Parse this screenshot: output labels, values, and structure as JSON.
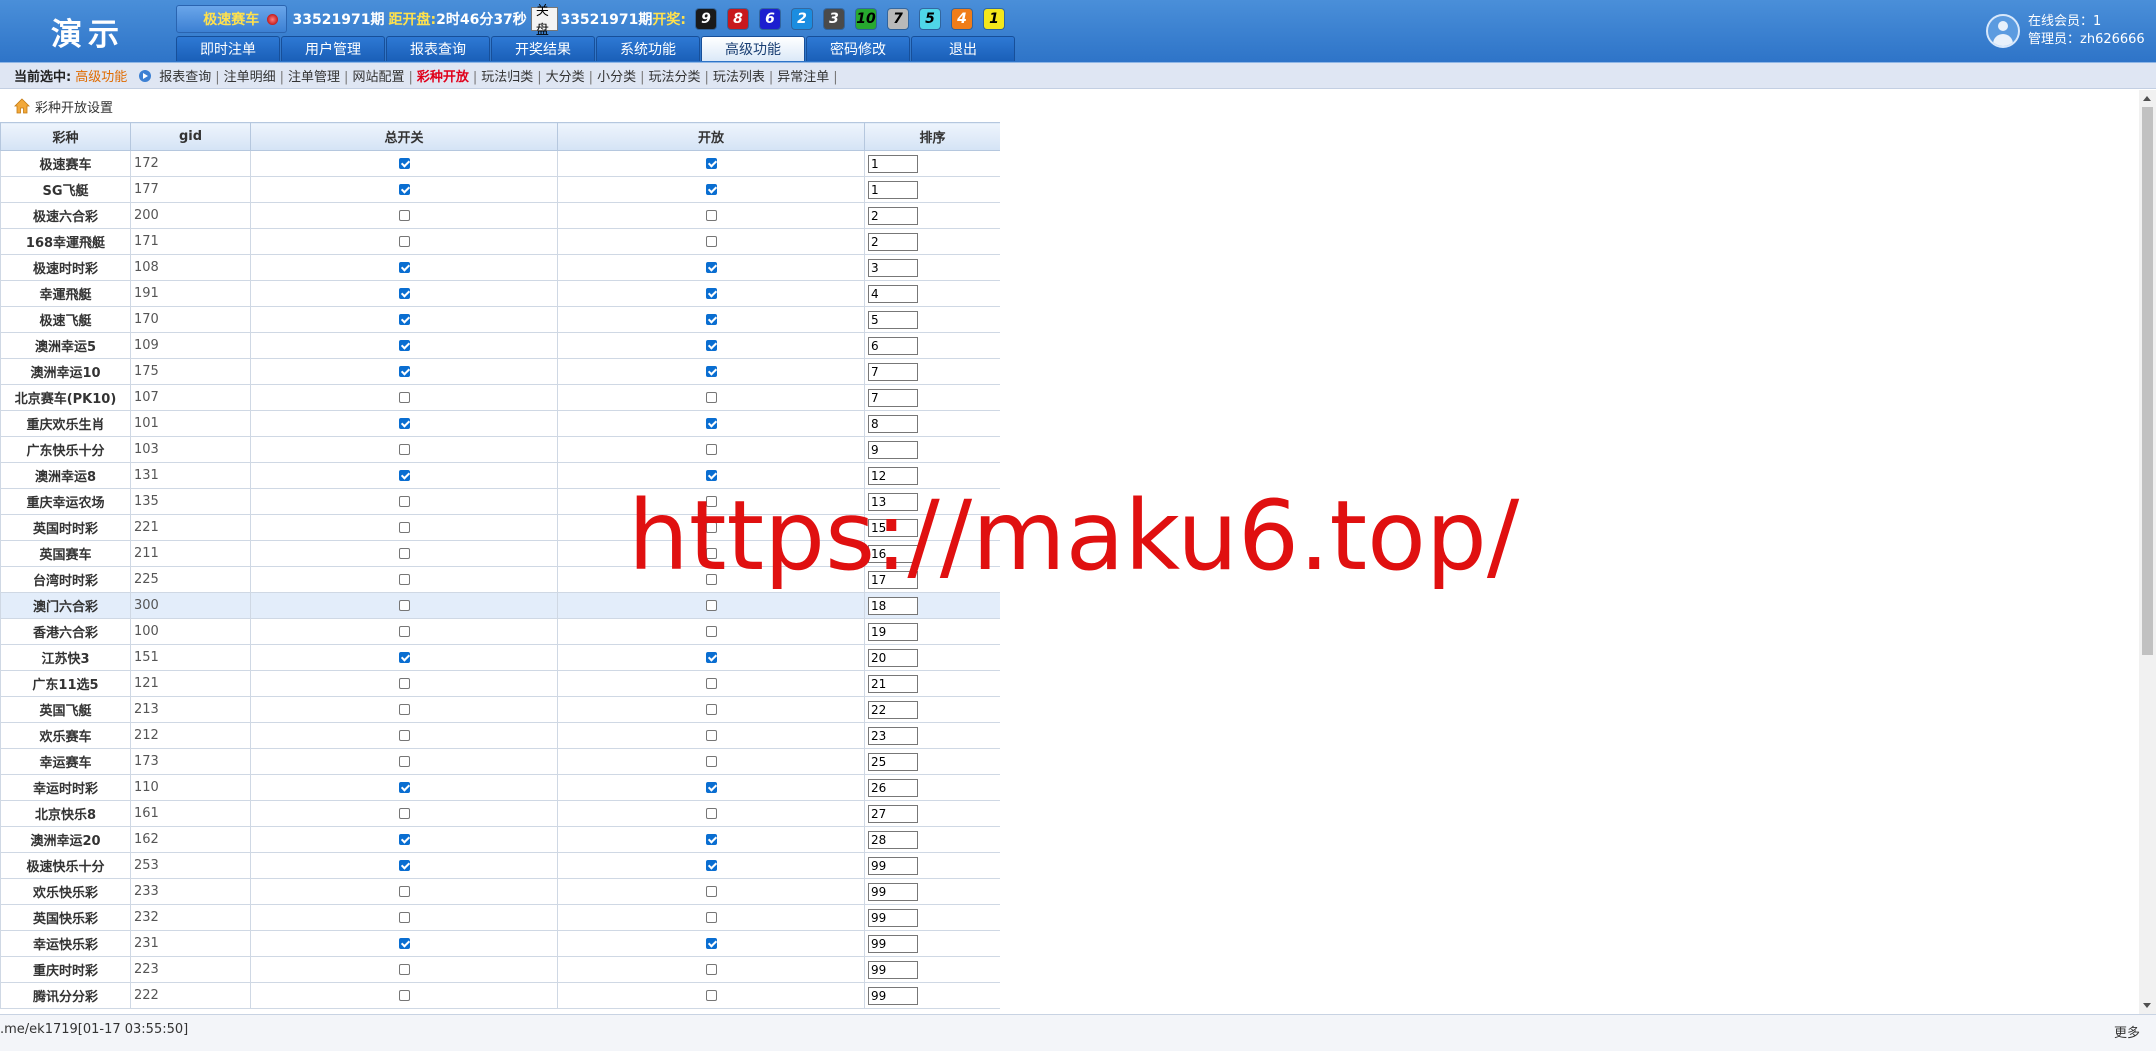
{
  "app": {
    "logo": "演示"
  },
  "topbar": {
    "game_name": "极速赛车",
    "period": "33521971期",
    "countdown_label": "距开盘:",
    "countdown": "2时46分37秒",
    "close_label": "关盘",
    "draw_period": "33521971期",
    "draw_label": "开奖:",
    "balls": [
      {
        "num": "9",
        "bg": "#1a1a1a",
        "fg": "#ffffff"
      },
      {
        "num": "8",
        "bg": "#c8191d",
        "fg": "#ffffff"
      },
      {
        "num": "6",
        "bg": "#1c1fcf",
        "fg": "#ffffff"
      },
      {
        "num": "2",
        "bg": "#1b8de0",
        "fg": "#ffffff"
      },
      {
        "num": "3",
        "bg": "#4a4a4a",
        "fg": "#ffffff"
      },
      {
        "num": "10",
        "bg": "#27a92f",
        "fg": "#000000"
      },
      {
        "num": "7",
        "bg": "#b9b9b9",
        "fg": "#000000"
      },
      {
        "num": "5",
        "bg": "#4fd6e8",
        "fg": "#000000"
      },
      {
        "num": "4",
        "bg": "#f07d19",
        "fg": "#ffffff"
      },
      {
        "num": "1",
        "bg": "#f4e71b",
        "fg": "#000000"
      }
    ]
  },
  "nav": {
    "tabs": [
      "即时注单",
      "用户管理",
      "报表查询",
      "开奖结果",
      "系统功能",
      "高级功能",
      "密码修改",
      "退出"
    ],
    "active_index": 5
  },
  "user": {
    "online_line": "在线会员：1",
    "admin_line": "管理员：zh626666"
  },
  "subnav": {
    "current_label": "当前选中:",
    "current_value": "高级功能",
    "links": [
      "报表查询",
      "注单明细",
      "注单管理",
      "网站配置",
      "彩种开放",
      "玩法归类",
      "大分类",
      "小分类",
      "玩法分类",
      "玩法列表",
      "异常注单"
    ],
    "active_index": 4
  },
  "page": {
    "title": "彩种开放设置"
  },
  "table": {
    "headers": {
      "name": "彩种",
      "gid": "gid",
      "master": "总开关",
      "open": "开放",
      "sort": "排序"
    },
    "rows": [
      {
        "name": "极速赛车",
        "gid": "172",
        "master": true,
        "open": true,
        "sort": "1"
      },
      {
        "name": "SG飞艇",
        "gid": "177",
        "master": true,
        "open": true,
        "sort": "1"
      },
      {
        "name": "极速六合彩",
        "gid": "200",
        "master": false,
        "open": false,
        "sort": "2"
      },
      {
        "name": "168幸運飛艇",
        "gid": "171",
        "master": false,
        "open": false,
        "sort": "2"
      },
      {
        "name": "极速时时彩",
        "gid": "108",
        "master": true,
        "open": true,
        "sort": "3"
      },
      {
        "name": "幸運飛艇",
        "gid": "191",
        "master": true,
        "open": true,
        "sort": "4"
      },
      {
        "name": "极速飞艇",
        "gid": "170",
        "master": true,
        "open": true,
        "sort": "5"
      },
      {
        "name": "澳洲幸运5",
        "gid": "109",
        "master": true,
        "open": true,
        "sort": "6"
      },
      {
        "name": "澳洲幸运10",
        "gid": "175",
        "master": true,
        "open": true,
        "sort": "7"
      },
      {
        "name": "北京赛车(PK10)",
        "gid": "107",
        "master": false,
        "open": false,
        "sort": "7"
      },
      {
        "name": "重庆欢乐生肖",
        "gid": "101",
        "master": true,
        "open": true,
        "sort": "8"
      },
      {
        "name": "广东快乐十分",
        "gid": "103",
        "master": false,
        "open": false,
        "sort": "9"
      },
      {
        "name": "澳洲幸运8",
        "gid": "131",
        "master": true,
        "open": true,
        "sort": "12"
      },
      {
        "name": "重庆幸运农场",
        "gid": "135",
        "master": false,
        "open": false,
        "sort": "13"
      },
      {
        "name": "英国时时彩",
        "gid": "221",
        "master": false,
        "open": false,
        "sort": "15"
      },
      {
        "name": "英国赛车",
        "gid": "211",
        "master": false,
        "open": false,
        "sort": "16"
      },
      {
        "name": "台湾时时彩",
        "gid": "225",
        "master": false,
        "open": false,
        "sort": "17"
      },
      {
        "name": "澳门六合彩",
        "gid": "300",
        "master": false,
        "open": false,
        "sort": "18"
      },
      {
        "name": "香港六合彩",
        "gid": "100",
        "master": false,
        "open": false,
        "sort": "19"
      },
      {
        "name": "江苏快3",
        "gid": "151",
        "master": true,
        "open": true,
        "sort": "20"
      },
      {
        "name": "广东11选5",
        "gid": "121",
        "master": false,
        "open": false,
        "sort": "21"
      },
      {
        "name": "英国飞艇",
        "gid": "213",
        "master": false,
        "open": false,
        "sort": "22"
      },
      {
        "name": "欢乐赛车",
        "gid": "212",
        "master": false,
        "open": false,
        "sort": "23"
      },
      {
        "name": "幸运赛车",
        "gid": "173",
        "master": false,
        "open": false,
        "sort": "25"
      },
      {
        "name": "幸运时时彩",
        "gid": "110",
        "master": true,
        "open": true,
        "sort": "26"
      },
      {
        "name": "北京快乐8",
        "gid": "161",
        "master": false,
        "open": false,
        "sort": "27"
      },
      {
        "name": "澳洲幸运20",
        "gid": "162",
        "master": true,
        "open": true,
        "sort": "28"
      },
      {
        "name": "极速快乐十分",
        "gid": "253",
        "master": true,
        "open": true,
        "sort": "99"
      },
      {
        "name": "欢乐快乐彩",
        "gid": "233",
        "master": false,
        "open": false,
        "sort": "99"
      },
      {
        "name": "英国快乐彩",
        "gid": "232",
        "master": false,
        "open": false,
        "sort": "99"
      },
      {
        "name": "幸运快乐彩",
        "gid": "231",
        "master": true,
        "open": true,
        "sort": "99"
      },
      {
        "name": "重庆时时彩",
        "gid": "223",
        "master": false,
        "open": false,
        "sort": "99"
      },
      {
        "name": "腾讯分分彩",
        "gid": "222",
        "master": false,
        "open": false,
        "sort": "99"
      }
    ],
    "highlight_index": 17
  },
  "footer": {
    "status": ".me/ek1719[01-17 03:55:50]",
    "more": "更多"
  },
  "watermark": "https://maku6.top/"
}
